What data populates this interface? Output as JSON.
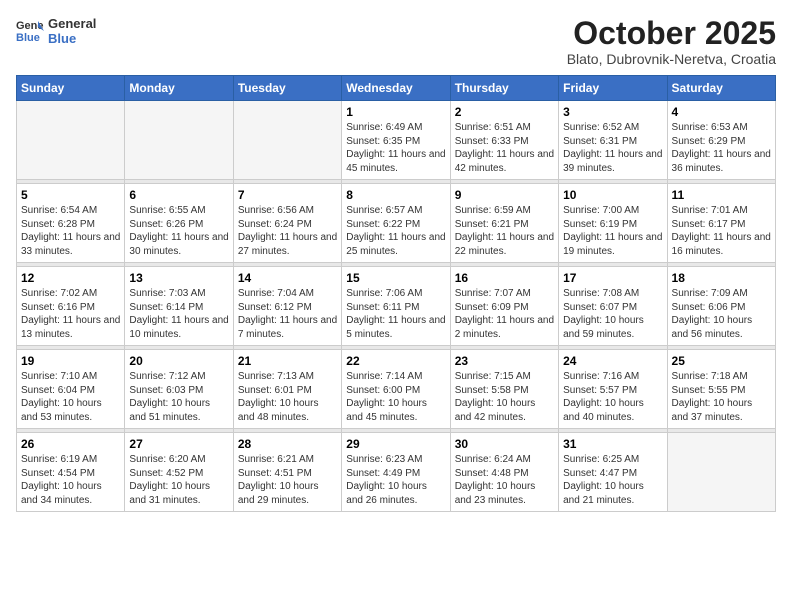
{
  "header": {
    "logo_general": "General",
    "logo_blue": "Blue",
    "title": "October 2025",
    "subtitle": "Blato, Dubrovnik-Neretva, Croatia"
  },
  "days_of_week": [
    "Sunday",
    "Monday",
    "Tuesday",
    "Wednesday",
    "Thursday",
    "Friday",
    "Saturday"
  ],
  "weeks": [
    [
      {
        "num": "",
        "info": ""
      },
      {
        "num": "",
        "info": ""
      },
      {
        "num": "",
        "info": ""
      },
      {
        "num": "1",
        "info": "Sunrise: 6:49 AM\nSunset: 6:35 PM\nDaylight: 11 hours and 45 minutes."
      },
      {
        "num": "2",
        "info": "Sunrise: 6:51 AM\nSunset: 6:33 PM\nDaylight: 11 hours and 42 minutes."
      },
      {
        "num": "3",
        "info": "Sunrise: 6:52 AM\nSunset: 6:31 PM\nDaylight: 11 hours and 39 minutes."
      },
      {
        "num": "4",
        "info": "Sunrise: 6:53 AM\nSunset: 6:29 PM\nDaylight: 11 hours and 36 minutes."
      }
    ],
    [
      {
        "num": "5",
        "info": "Sunrise: 6:54 AM\nSunset: 6:28 PM\nDaylight: 11 hours and 33 minutes."
      },
      {
        "num": "6",
        "info": "Sunrise: 6:55 AM\nSunset: 6:26 PM\nDaylight: 11 hours and 30 minutes."
      },
      {
        "num": "7",
        "info": "Sunrise: 6:56 AM\nSunset: 6:24 PM\nDaylight: 11 hours and 27 minutes."
      },
      {
        "num": "8",
        "info": "Sunrise: 6:57 AM\nSunset: 6:22 PM\nDaylight: 11 hours and 25 minutes."
      },
      {
        "num": "9",
        "info": "Sunrise: 6:59 AM\nSunset: 6:21 PM\nDaylight: 11 hours and 22 minutes."
      },
      {
        "num": "10",
        "info": "Sunrise: 7:00 AM\nSunset: 6:19 PM\nDaylight: 11 hours and 19 minutes."
      },
      {
        "num": "11",
        "info": "Sunrise: 7:01 AM\nSunset: 6:17 PM\nDaylight: 11 hours and 16 minutes."
      }
    ],
    [
      {
        "num": "12",
        "info": "Sunrise: 7:02 AM\nSunset: 6:16 PM\nDaylight: 11 hours and 13 minutes."
      },
      {
        "num": "13",
        "info": "Sunrise: 7:03 AM\nSunset: 6:14 PM\nDaylight: 11 hours and 10 minutes."
      },
      {
        "num": "14",
        "info": "Sunrise: 7:04 AM\nSunset: 6:12 PM\nDaylight: 11 hours and 7 minutes."
      },
      {
        "num": "15",
        "info": "Sunrise: 7:06 AM\nSunset: 6:11 PM\nDaylight: 11 hours and 5 minutes."
      },
      {
        "num": "16",
        "info": "Sunrise: 7:07 AM\nSunset: 6:09 PM\nDaylight: 11 hours and 2 minutes."
      },
      {
        "num": "17",
        "info": "Sunrise: 7:08 AM\nSunset: 6:07 PM\nDaylight: 10 hours and 59 minutes."
      },
      {
        "num": "18",
        "info": "Sunrise: 7:09 AM\nSunset: 6:06 PM\nDaylight: 10 hours and 56 minutes."
      }
    ],
    [
      {
        "num": "19",
        "info": "Sunrise: 7:10 AM\nSunset: 6:04 PM\nDaylight: 10 hours and 53 minutes."
      },
      {
        "num": "20",
        "info": "Sunrise: 7:12 AM\nSunset: 6:03 PM\nDaylight: 10 hours and 51 minutes."
      },
      {
        "num": "21",
        "info": "Sunrise: 7:13 AM\nSunset: 6:01 PM\nDaylight: 10 hours and 48 minutes."
      },
      {
        "num": "22",
        "info": "Sunrise: 7:14 AM\nSunset: 6:00 PM\nDaylight: 10 hours and 45 minutes."
      },
      {
        "num": "23",
        "info": "Sunrise: 7:15 AM\nSunset: 5:58 PM\nDaylight: 10 hours and 42 minutes."
      },
      {
        "num": "24",
        "info": "Sunrise: 7:16 AM\nSunset: 5:57 PM\nDaylight: 10 hours and 40 minutes."
      },
      {
        "num": "25",
        "info": "Sunrise: 7:18 AM\nSunset: 5:55 PM\nDaylight: 10 hours and 37 minutes."
      }
    ],
    [
      {
        "num": "26",
        "info": "Sunrise: 6:19 AM\nSunset: 4:54 PM\nDaylight: 10 hours and 34 minutes."
      },
      {
        "num": "27",
        "info": "Sunrise: 6:20 AM\nSunset: 4:52 PM\nDaylight: 10 hours and 31 minutes."
      },
      {
        "num": "28",
        "info": "Sunrise: 6:21 AM\nSunset: 4:51 PM\nDaylight: 10 hours and 29 minutes."
      },
      {
        "num": "29",
        "info": "Sunrise: 6:23 AM\nSunset: 4:49 PM\nDaylight: 10 hours and 26 minutes."
      },
      {
        "num": "30",
        "info": "Sunrise: 6:24 AM\nSunset: 4:48 PM\nDaylight: 10 hours and 23 minutes."
      },
      {
        "num": "31",
        "info": "Sunrise: 6:25 AM\nSunset: 4:47 PM\nDaylight: 10 hours and 21 minutes."
      },
      {
        "num": "",
        "info": ""
      }
    ]
  ]
}
